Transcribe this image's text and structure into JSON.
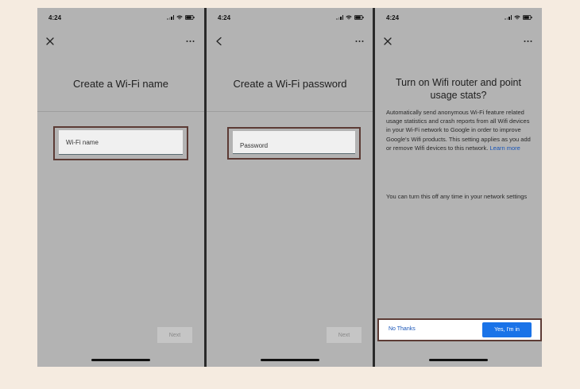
{
  "screens": [
    {
      "time": "4:24",
      "title": "Create a Wi-Fi name",
      "field_label": "Wi-Fi name",
      "next_label": "Next",
      "nav_icon": "close-icon",
      "menu_icon": "more-icon"
    },
    {
      "time": "4:24",
      "title": "Create a Wi-Fi password",
      "field_label": "Password",
      "next_label": "Next",
      "nav_icon": "back-icon",
      "menu_icon": "more-icon"
    },
    {
      "time": "4:24",
      "title": "Turn on Wifi router and point usage stats?",
      "body": "Automatically send anonymous Wi-Fi feature related usage statistics and crash reports from all Wifi devices in your Wi-Fi network to Google in order to improve Google's Wifi products. This setting applies as you add or remove Wifi devices to this network.",
      "learn_more": "Learn more",
      "note": "You can turn this off any time in your network settings",
      "no_thanks": "No Thanks",
      "yes": "Yes, I'm in",
      "nav_icon": "close-icon",
      "menu_icon": "more-icon"
    }
  ],
  "colors": {
    "background": "#f5ebe0",
    "screen_overlay": "#b3b3b3",
    "highlight_border": "#5c3b35",
    "primary_button": "#1a73e8",
    "link": "#1a56b8"
  }
}
